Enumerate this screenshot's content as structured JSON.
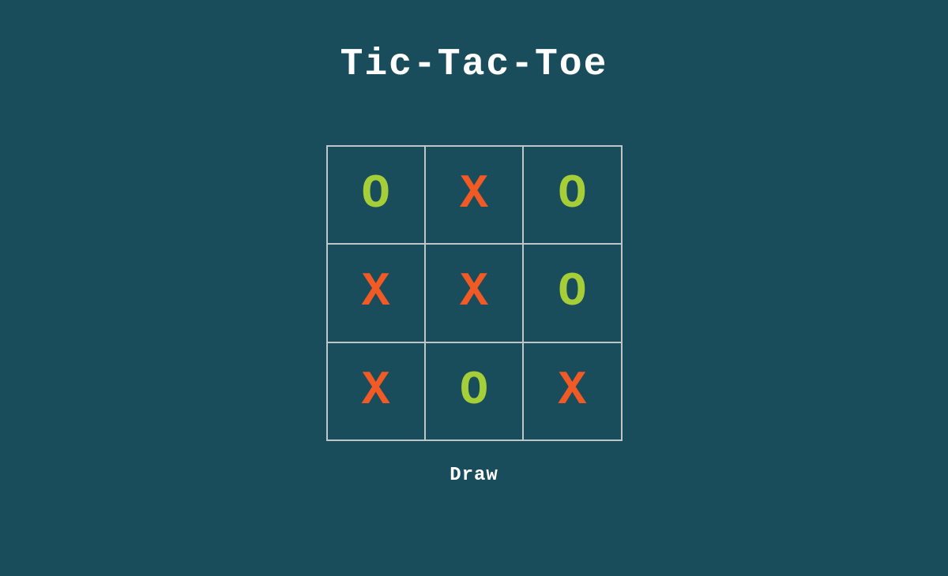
{
  "title": "Tic-Tac-Toe",
  "status": "Draw",
  "colors": {
    "background": "#1a4d5c",
    "grid": "#c0c5c7",
    "x": "#f15a24",
    "o": "#a6ce39",
    "text": "#ffffff"
  },
  "board": {
    "cells": [
      {
        "mark": "O"
      },
      {
        "mark": "X"
      },
      {
        "mark": "O"
      },
      {
        "mark": "X"
      },
      {
        "mark": "X"
      },
      {
        "mark": "O"
      },
      {
        "mark": "X"
      },
      {
        "mark": "O"
      },
      {
        "mark": "X"
      }
    ]
  }
}
